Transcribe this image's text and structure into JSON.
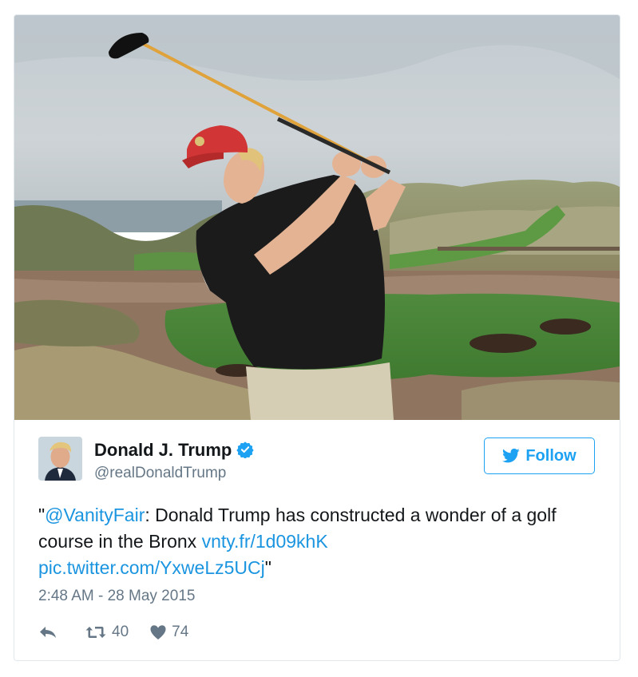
{
  "user": {
    "name": "Donald J. Trump",
    "handle": "@realDonaldTrump"
  },
  "follow_label": "Follow",
  "tweet": {
    "open_quote": "\"",
    "mention": "@VanityFair",
    "text_part": ": Donald Trump has constructed a wonder of a golf course in the Bronx ",
    "link1": "vnty.fr/1d09khK",
    "link2": "pic.twitter.com/YxweLz5UCj",
    "close_quote": "\""
  },
  "timestamp": "2:48 AM - 28 May 2015",
  "actions": {
    "retweets": "40",
    "likes": "74"
  },
  "colors": {
    "accent": "#1da1f2",
    "link": "#1b95e0",
    "secondary_text": "#657786"
  },
  "icons": [
    "verified-badge-icon",
    "twitter-bird-icon",
    "reply-icon",
    "retweet-icon",
    "heart-icon"
  ]
}
